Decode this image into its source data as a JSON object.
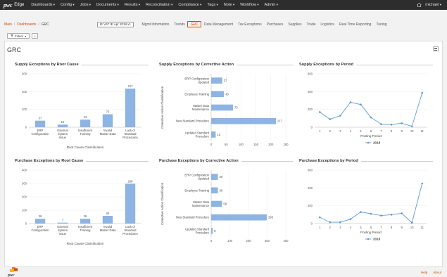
{
  "app": {
    "logo_text": "pwc",
    "product": "Edge",
    "nav": [
      "Dashboards",
      "Config",
      "Jobs",
      "Documents",
      "Results",
      "Reconciliation",
      "Compliance",
      "Tags",
      "Note",
      "Workflow",
      "Admin"
    ],
    "user": "michael"
  },
  "breadcrumb": {
    "items": [
      "Main",
      "Dashboards",
      "GRC"
    ]
  },
  "vat_selector": "IE VAT IE Apr 2018 v1",
  "tabs": [
    "Mgmt Information",
    "Trends",
    "GRC",
    "Data Management",
    "Tax Exceptions",
    "Purchases",
    "Supplies",
    "Trade",
    "Logistics",
    "Real Time Reporting",
    "Tuning"
  ],
  "active_tab": "GRC",
  "filters": {
    "label": "Filters",
    "add": "+"
  },
  "page_title": "GRC",
  "footer": {
    "links": [
      "Help",
      "About"
    ]
  },
  "colors": {
    "bar": "#8db4e2",
    "line": "#5b9bd5",
    "accent": "#d04a02",
    "nav_bg": "#2d2d2d"
  },
  "chart_data": [
    {
      "id": "supply_root",
      "type": "bar",
      "title": "Supply Exceptions by Root Cause",
      "categories": [
        "ERP Configuration",
        "External System Issue",
        "Insufficient Training",
        "Invalid Master Data",
        "Lack of Standard Procedures"
      ],
      "values": [
        37,
        15,
        43,
        73,
        217
      ],
      "xlabel": "Root Cause Classification",
      "ylim": [
        0,
        300
      ],
      "yticks": [
        0,
        100,
        200,
        300
      ]
    },
    {
      "id": "supply_corrective",
      "type": "bar",
      "orientation": "horizontal",
      "title": "Supply Exceptions by Corrective Action",
      "categories": [
        "ERP Configuration Updated",
        "Employee Training",
        "Master Data Maintenance",
        "New Standard Procedure",
        "Updated Standard Procedure"
      ],
      "values": [
        37,
        43,
        73,
        217,
        15
      ],
      "ylabel": "Corrective Action Classification",
      "xlim": [
        0,
        250
      ],
      "xticks": [
        0,
        50,
        100,
        150,
        200,
        250
      ]
    },
    {
      "id": "supply_period",
      "type": "line",
      "title": "Supply Exceptions by Period",
      "x": [
        1,
        2,
        3,
        4,
        5,
        6,
        7,
        8,
        9,
        10,
        11
      ],
      "series": [
        {
          "name": "2018",
          "values": [
            170,
            90,
            130,
            280,
            255,
            110,
            35,
            30,
            45,
            10,
            385
          ]
        }
      ],
      "xlabel": "Posting Period",
      "ylim": [
        0,
        600
      ],
      "yticks": [
        0,
        200,
        400,
        600
      ]
    },
    {
      "id": "purchase_root",
      "type": "bar",
      "title": "Purchase Exceptions by Root Cause",
      "categories": [
        "ERP Configuration",
        "External System Issue",
        "Insufficient Training",
        "Invalid Master Data",
        "Lack of Standard Procedures"
      ],
      "values": [
        36,
        7,
        36,
        58,
        298
      ],
      "xlabel": "Root Cause Classification",
      "ylim": [
        0,
        400
      ],
      "yticks": [
        0,
        100,
        200,
        300,
        400
      ]
    },
    {
      "id": "purchase_corrective",
      "type": "bar",
      "orientation": "horizontal",
      "title": "Purchase Exceptions by Corrective Action",
      "categories": [
        "ERP Configuration Updated",
        "Employee Training",
        "Master Data Maintenance",
        "New Standard Procedure",
        "Updated Standard Procedure"
      ],
      "values": [
        36,
        36,
        58,
        298,
        8
      ],
      "ylabel": "Corrective Action Classification",
      "xlim": [
        0,
        400
      ],
      "xticks": [
        0,
        100,
        200,
        300,
        400
      ]
    },
    {
      "id": "purchase_period",
      "type": "line",
      "title": "Purchase Exceptions by Period",
      "x": [
        1,
        2,
        3,
        4,
        5,
        6,
        7,
        8,
        9,
        10,
        11
      ],
      "series": [
        {
          "name": "2018",
          "values": [
            70,
            15,
            15,
            50,
            130,
            110,
            90,
            100,
            115,
            10,
            450
          ]
        }
      ],
      "xlabel": "Posting Period",
      "ylim": [
        0,
        600
      ],
      "yticks": [
        0,
        200,
        400,
        600
      ]
    }
  ]
}
